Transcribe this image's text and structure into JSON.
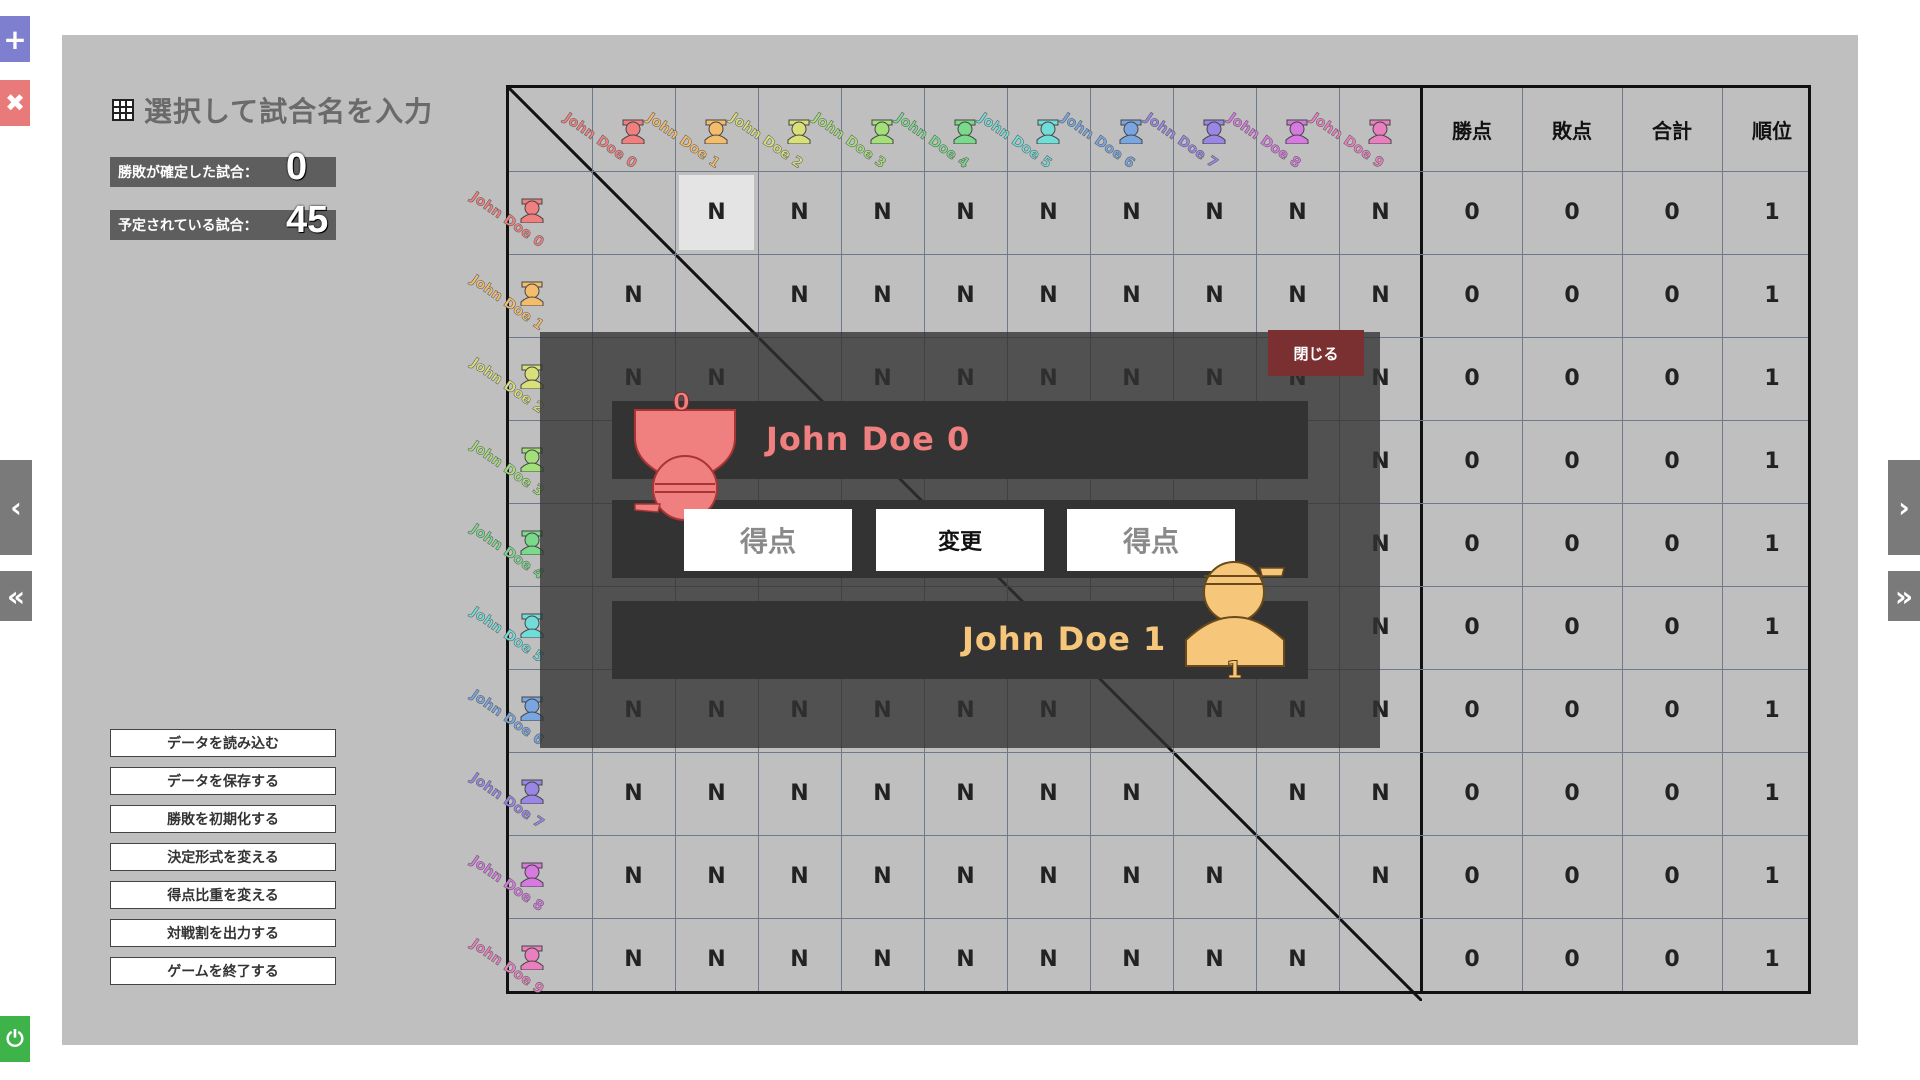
{
  "title": "選択して試合名を入力",
  "stats": {
    "confirmed_label": "勝敗が確定した試合：",
    "confirmed_value": "0",
    "scheduled_label": "予定されている試合：",
    "scheduled_value": "45"
  },
  "menu": [
    "データを読み込む",
    "データを保存する",
    "勝敗を初期化する",
    "決定形式を変える",
    "得点比重を変える",
    "対戦割を出力する",
    "ゲームを終了する"
  ],
  "edge_icons": {
    "add": "+",
    "delete": "✖",
    "power": "⏻",
    "prev": "‹",
    "first": "«",
    "next": "›",
    "last": "»"
  },
  "players": [
    {
      "name": "John Doe 0",
      "color": "#f07f7f"
    },
    {
      "name": "John Doe 1",
      "color": "#f4bd6c"
    },
    {
      "name": "John Doe 2",
      "color": "#d9e07a"
    },
    {
      "name": "John Doe 3",
      "color": "#a4e07a"
    },
    {
      "name": "John Doe 4",
      "color": "#7ad98a"
    },
    {
      "name": "John Doe 5",
      "color": "#72dcd8"
    },
    {
      "name": "John Doe 6",
      "color": "#79a6e0"
    },
    {
      "name": "John Doe 7",
      "color": "#9a86e4"
    },
    {
      "name": "John Doe 8",
      "color": "#d67ae0"
    },
    {
      "name": "John Doe 9",
      "color": "#ea7fc0"
    }
  ],
  "stat_headers": [
    "勝点",
    "敗点",
    "合計",
    "順位"
  ],
  "cell_mark": "N",
  "rows_stats": [
    [
      "0",
      "0",
      "0",
      "1"
    ],
    [
      "0",
      "0",
      "0",
      "1"
    ],
    [
      "0",
      "0",
      "0",
      "1"
    ],
    [
      "0",
      "0",
      "0",
      "1"
    ],
    [
      "0",
      "0",
      "0",
      "1"
    ],
    [
      "0",
      "0",
      "0",
      "1"
    ],
    [
      "0",
      "0",
      "0",
      "1"
    ],
    [
      "0",
      "0",
      "0",
      "1"
    ],
    [
      "0",
      "0",
      "0",
      "1"
    ],
    [
      "0",
      "0",
      "0",
      "1"
    ]
  ],
  "match_dialog": {
    "close_label": "閉じる",
    "player_a": {
      "name": "John Doe 0",
      "number": "0",
      "color": "#f07f7f"
    },
    "player_b": {
      "name": "John Doe 1",
      "number": "1",
      "color": "#f4bd6c"
    },
    "score_a_label": "得点",
    "swap_label": "変更",
    "score_b_label": "得点"
  }
}
